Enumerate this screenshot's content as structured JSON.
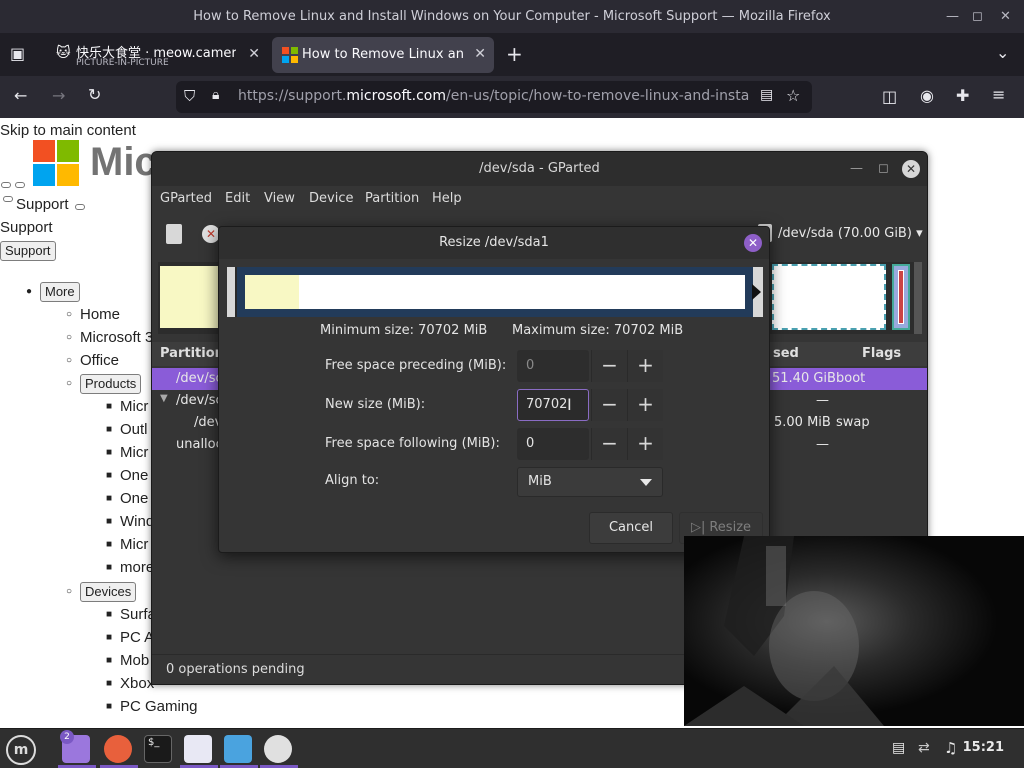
{
  "firefox": {
    "window_title": "How to Remove Linux and Install Windows on Your Computer - Microsoft Support — Mozilla Firefox",
    "tabs": [
      {
        "title": "快乐大食堂 · meow.camera",
        "subtitle": "PICTURE-IN-PICTURE"
      },
      {
        "title": "How to Remove Linux and I"
      }
    ],
    "url_prefix": "https://support.",
    "url_domain": "microsoft.com",
    "url_rest": "/en-us/topic/how-to-remove-linux-and-install-windo"
  },
  "webpage": {
    "skip_link": "Skip to main content",
    "logo_text": "Mic",
    "support_link": "Support",
    "support_text": "Support",
    "support_button": "Support",
    "more_button": "More",
    "nav_items": [
      "Home",
      "Microsoft 3",
      "Office"
    ],
    "products_button": "Products",
    "product_items": [
      "Micr",
      "Outl",
      "Micr",
      "One",
      "One",
      "Wind",
      "Micr",
      "more"
    ],
    "devices_button": "Devices",
    "device_items": [
      "Surfa",
      "PC A",
      "Mob",
      "Xbox",
      "PC Gaming"
    ]
  },
  "gparted": {
    "title": "/dev/sda - GParted",
    "menu": [
      "GParted",
      "Edit",
      "View",
      "Device",
      "Partition",
      "Help"
    ],
    "device_selector": "/dev/sda (70.00 GiB)",
    "columns": {
      "partition": "Partition",
      "used": "sed",
      "flags": "Flags"
    },
    "rows": [
      {
        "partition": "/dev/sc",
        "used": "51.40 GiB",
        "flags": "boot"
      },
      {
        "partition": "/dev/sc",
        "used": "—",
        "flags": ""
      },
      {
        "partition": "/dev",
        "used": "5.00 MiB",
        "flags": "swap"
      },
      {
        "partition": "unalloc",
        "used": "—",
        "flags": ""
      }
    ],
    "status": "0 operations pending"
  },
  "resize_dialog": {
    "title": "Resize /dev/sda1",
    "min_size": "Minimum size: 70702 MiB",
    "max_size": "Maximum size: 70702 MiB",
    "free_preceding_label": "Free space preceding (MiB):",
    "free_preceding_value": "0",
    "new_size_label": "New size (MiB):",
    "new_size_value": "70702",
    "free_following_label": "Free space following (MiB):",
    "free_following_value": "0",
    "align_label": "Align to:",
    "align_value": "MiB",
    "cancel_label": "Cancel",
    "resize_label": "Resize"
  },
  "taskbar": {
    "folder_badge": "2",
    "clock": "15:21"
  },
  "colors": {
    "accent": "#8e5fc8",
    "selection": "#8a5cd8",
    "partition_fill": "#f8f8c4",
    "partition_frame": "#223b5a"
  }
}
